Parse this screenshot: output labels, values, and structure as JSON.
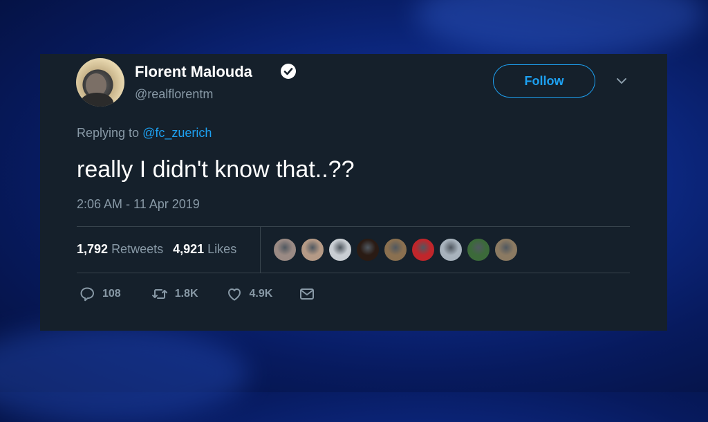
{
  "tweet": {
    "display_name": "Florent Malouda",
    "handle": "@realflorentm",
    "follow_label": "Follow",
    "reply_prefix": "Replying to",
    "reply_mention": "@fc_zuerich",
    "text": "really I didn't know that..??",
    "timestamp": "2:06 AM - 11 Apr 2019"
  },
  "stats": {
    "retweets_count": "1,792",
    "retweets_label": "Retweets",
    "likes_count": "4,921",
    "likes_label": "Likes"
  },
  "actions": {
    "replies": "108",
    "retweets": "1.8K",
    "likes": "4.9K"
  },
  "liker_avatar_colors": [
    "#9a8a84",
    "#b59a86",
    "#c9ced3",
    "#2a1b14",
    "#8a7050",
    "#c0262b",
    "#a8b3bd",
    "#3c6a3a",
    "#8b7a62"
  ],
  "colors": {
    "card_bg": "#15202b",
    "accent": "#1da1f2",
    "muted": "#8899a6"
  },
  "icons": [
    "verified-badge-icon",
    "chevron-down-icon",
    "reply-icon",
    "retweet-icon",
    "like-icon",
    "message-icon"
  ]
}
